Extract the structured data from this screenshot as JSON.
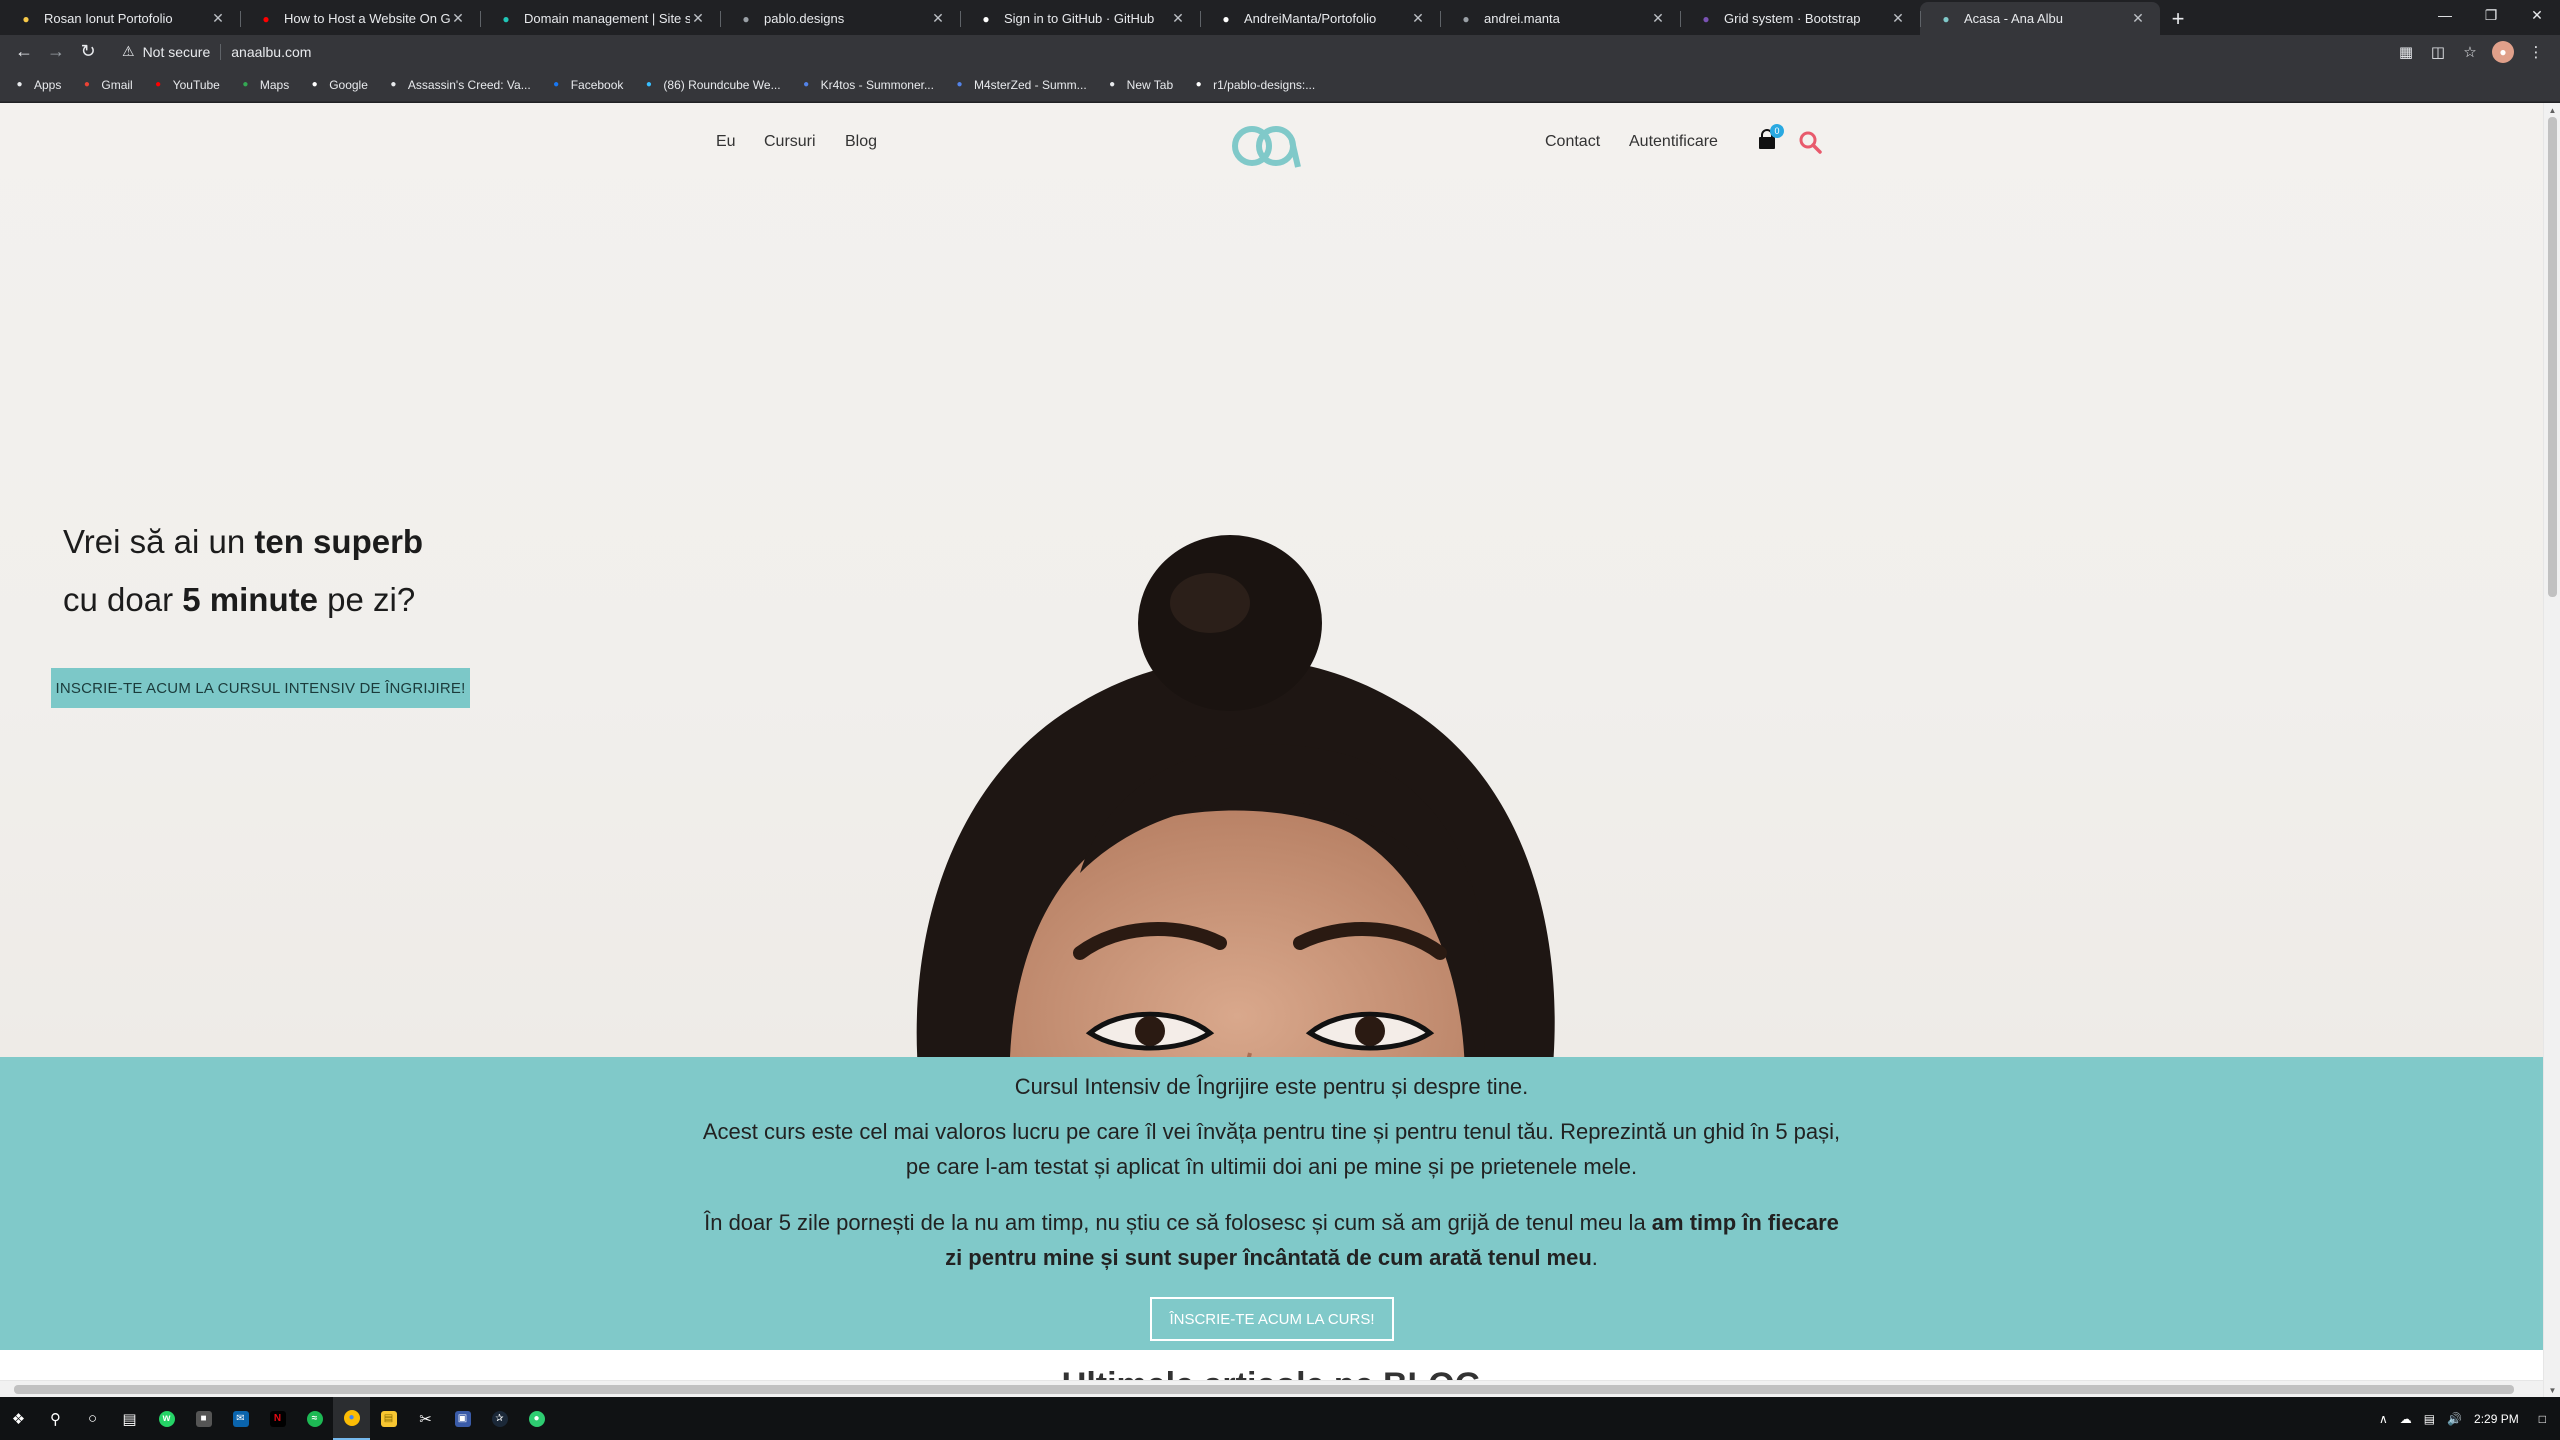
{
  "browser": {
    "tabs": [
      {
        "title": "Rosan Ionut Portofolio",
        "icon": "bolt-icon",
        "color": "#f7c948"
      },
      {
        "title": "How to Host a Website On Github",
        "icon": "youtube-icon",
        "color": "#ff0000"
      },
      {
        "title": "Domain management | Site settings",
        "icon": "netlify-icon",
        "color": "#20c6b7"
      },
      {
        "title": "pablo.designs",
        "icon": "globe-icon",
        "color": "#9aa0a6"
      },
      {
        "title": "Sign in to GitHub · GitHub",
        "icon": "github-icon",
        "color": "#ffffff"
      },
      {
        "title": "AndreiManta/Portofolio",
        "icon": "github-icon",
        "color": "#ffffff"
      },
      {
        "title": "andrei.manta",
        "icon": "globe-icon",
        "color": "#9aa0a6"
      },
      {
        "title": "Grid system · Bootstrap",
        "icon": "bootstrap-icon",
        "color": "#7952b3"
      },
      {
        "title": "Acasa - Ana Albu",
        "icon": "site-logo-icon",
        "color": "#80c9c9",
        "active": true
      }
    ],
    "security_label": "Not secure",
    "url": "anaalbu.com",
    "bookmarks": [
      {
        "label": "Apps",
        "icon": "apps-icon",
        "color": "#e8eaed"
      },
      {
        "label": "Gmail",
        "icon": "gmail-icon",
        "color": "#ea4335"
      },
      {
        "label": "YouTube",
        "icon": "youtube-icon",
        "color": "#ff0000"
      },
      {
        "label": "Maps",
        "icon": "maps-icon",
        "color": "#34a853"
      },
      {
        "label": "Google",
        "icon": "google-icon",
        "color": "#ffffff"
      },
      {
        "label": "Assassin's Creed: Va...",
        "icon": "globe-icon",
        "color": "#e8eaed"
      },
      {
        "label": "Facebook",
        "icon": "facebook-icon",
        "color": "#1877f2"
      },
      {
        "label": "(86) Roundcube We...",
        "icon": "roundcube-icon",
        "color": "#37beff"
      },
      {
        "label": "Kr4tos - Summoner...",
        "icon": "opgg-icon",
        "color": "#5383e8"
      },
      {
        "label": "M4sterZed - Summ...",
        "icon": "opgg-icon",
        "color": "#5383e8"
      },
      {
        "label": "New Tab",
        "icon": "globe-icon",
        "color": "#e8eaed"
      },
      {
        "label": "r1/pablo-designs:...",
        "icon": "github-icon",
        "color": "#ffffff"
      }
    ]
  },
  "site": {
    "nav_left": [
      "Eu",
      "Cursuri",
      "Blog"
    ],
    "nav_right": [
      "Contact",
      "Autentificare"
    ],
    "cart_count": "0",
    "brand_color": "#80c9c9",
    "hero": {
      "line1_a": "Vrei să ai un ",
      "line1_b": "ten superb",
      "line2_a": "cu doar ",
      "line2_b": "5 minute",
      "line2_c": " pe zi?",
      "cta": "INSCRIE-TE ACUM LA CURSUL INTENSIV DE ÎNGRIJIRE!"
    },
    "intro": {
      "p1": "Cursul Intensiv de Îngrijire este pentru și despre tine.",
      "p2": "Acest curs este cel mai valoros lucru pe care îl vei învăța pentru tine și pentru tenul tău. Reprezintă un ghid în 5 pași, pe care l-am testat și aplicat în ultimii doi ani pe mine și pe prietenele mele.",
      "p3_a": "În doar 5 zile pornești de la nu am timp, nu știu ce să folosesc și cum să am grijă de tenul meu la ",
      "p3_b": "am timp în fiecare zi pentru mine și sunt super încântată de cum arată tenul meu",
      "p3_c": ".",
      "cta": "ÎNSCRIE-TE ACUM LA CURS!"
    },
    "blog_heading": "Ultimele articole pe BLOG"
  },
  "taskbar": {
    "time": "2:29 PM"
  }
}
